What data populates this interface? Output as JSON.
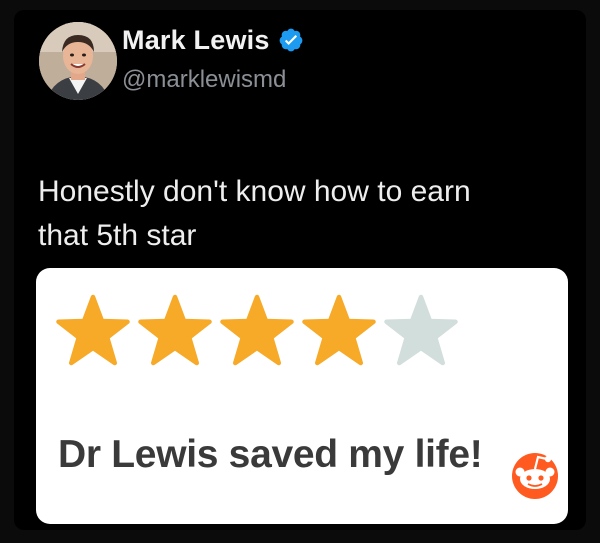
{
  "tweet": {
    "author": {
      "display_name": "Mark Lewis",
      "handle": "@marklewismd",
      "verified": true,
      "verified_badge_color": "#1d9bf0",
      "avatar_icon": "profile-photo"
    },
    "text_lines": [
      "Honestly don't know how to earn",
      "that 5th star"
    ],
    "review_card": {
      "rating": 4,
      "max_rating": 5,
      "filled_star_color": "#f7a928",
      "empty_star_color": "#d2dedb",
      "review_text": "Dr Lewis saved my life!"
    }
  },
  "watermark": {
    "icon": "reddit-icon",
    "color": "#ff5a1f"
  }
}
